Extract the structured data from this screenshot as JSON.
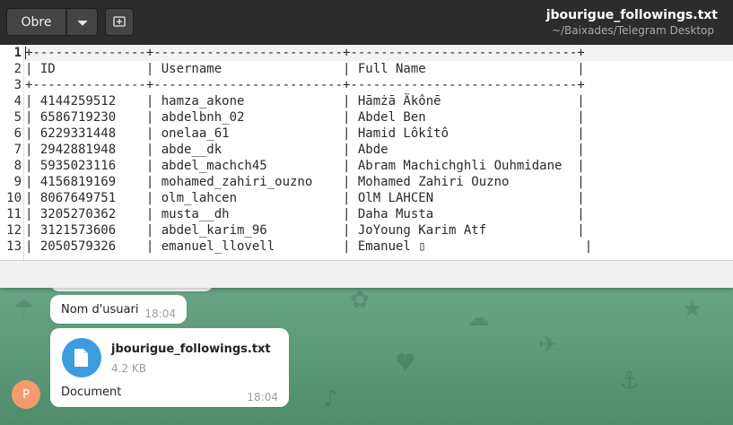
{
  "editor_window": {
    "open_label": "Obre",
    "title": "jbourigue_followings.txt",
    "subtitle": "~/Baixades/Telegram Desktop",
    "lines": [
      {
        "n": "1",
        "t": "+---------------+-------------------------+------------------------------+"
      },
      {
        "n": "2",
        "t": "| ID            | Username                | Full Name                    |"
      },
      {
        "n": "3",
        "t": "+---------------+-------------------------+------------------------------+"
      },
      {
        "n": "4",
        "t": "| 4144259512    | hamza_akone             | Hāmżā Äkônē                  |"
      },
      {
        "n": "5",
        "t": "| 6586719230    | abdelbnh_02             | Abdel Ben                    |"
      },
      {
        "n": "6",
        "t": "| 6229331448    | onelaa_61               | Hamid Lôkîtô                 |"
      },
      {
        "n": "7",
        "t": "| 2942881948    | abde__dk                | Abde                         |"
      },
      {
        "n": "8",
        "t": "| 5935023116    | abdel_machch45          | Abram Machichghli Ouhmidane  |"
      },
      {
        "n": "9",
        "t": "| 4156819169    | mohamed_zahiri_ouzno    | Mohamed Zahiri Ouzno         |"
      },
      {
        "n": "10",
        "t": "| 8067649751    | olm_lahcen              | OlM LAHCEN                   |"
      },
      {
        "n": "11",
        "t": "| 3205270362    | musta__dh               | Daha Musta                   |"
      },
      {
        "n": "12",
        "t": "| 3121573606    | abdel_karim_96          | JoYoung Karim Atf            |"
      },
      {
        "n": "13",
        "t": "| 2050579326    | emanuel_llovell         | Emanuel ▯                     |"
      }
    ]
  },
  "telegram": {
    "message_username_text": "Nom d'usuari",
    "message_username_time": "18:04",
    "file_name": "jbourigue_followings.txt",
    "file_size": "4.2 KB",
    "file_caption": "Document",
    "file_time": "18:04",
    "avatar_letter": "P"
  },
  "colors": {
    "headerbar": "#2c2c2c",
    "telegram_bg": "#5d9a7c",
    "file_icon": "#3d9be0",
    "avatar": "#f59a6e"
  }
}
